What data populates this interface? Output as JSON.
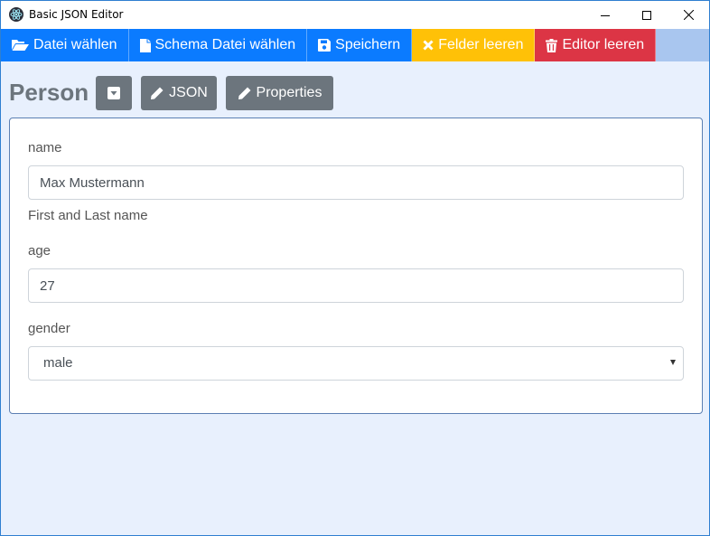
{
  "window": {
    "title": "Basic JSON Editor"
  },
  "toolbar": {
    "open_file": "Datei wählen",
    "open_schema": "Schema Datei wählen",
    "save": "Speichern",
    "clear_fields": "Felder leeren",
    "clear_editor": "Editor leeren"
  },
  "editor": {
    "heading": "Person",
    "json_button": "JSON",
    "properties_button": "Properties",
    "fields": {
      "name": {
        "label": "name",
        "value": "Max Mustermann",
        "help": "First and Last name"
      },
      "age": {
        "label": "age",
        "value": "27"
      },
      "gender": {
        "label": "gender",
        "value": "male"
      }
    }
  },
  "colors": {
    "primary": "#0b7bff",
    "warning": "#ffc107",
    "danger": "#dc3545",
    "secondary": "#6c757d",
    "background": "#e8f0fd"
  },
  "icons": {
    "app": "electron-icon",
    "open_file": "folder-open-icon",
    "open_schema": "file-icon",
    "save": "floppy-disk-icon",
    "clear_fields": "times-icon",
    "clear_editor": "trash-icon",
    "collapse": "caret-square-down-icon",
    "json": "pencil-icon",
    "properties": "pencil-icon"
  }
}
